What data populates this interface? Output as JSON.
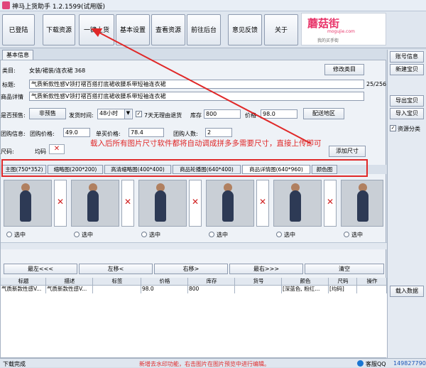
{
  "window": {
    "title": "神马上货助手 1.2.1599(试用版)"
  },
  "toolbar": {
    "buttons": [
      "已登陆",
      "下载资源",
      "一键上货",
      "基本设置",
      "查看资源",
      "前往后台",
      "意见反馈",
      "关于"
    ]
  },
  "logo": {
    "brand": "蘑菇街",
    "domain": "mogujie.com",
    "tagline": "我的买手街"
  },
  "tabs": {
    "basic": "基本信息"
  },
  "form": {
    "category_label": "类目:",
    "category_value": "女装/裙装/连衣裙   368",
    "modify_category": "修改类目",
    "title_label": "标题:",
    "title_value": "气质新款性感V领打褶百搭打底裙收腰系带短袖连衣裙",
    "title_count": "25/256",
    "detail_label": "商品详情",
    "detail_value": "气质新款性感V领打褶百搭打底裙收腰系带短袖连衣裙",
    "presale_label": "是否预售:",
    "presale_btn": "非预售",
    "ship_label": "发货时间:",
    "ship_value": "48小时",
    "refund_label": "7天无理由退货",
    "refund_checked": true,
    "stock_label": "库存",
    "stock_value": "800",
    "price_label": "价格",
    "price_value": "98.0",
    "region_btn": "配送地区",
    "group_label": "团购信息:",
    "group_price_label": "团购价格:",
    "group_price_value": "49.0",
    "single_price_label": "单买价格:",
    "single_price_value": "78.4",
    "group_size_label": "团购人数:",
    "group_size_value": "2",
    "size_label": "尺码:",
    "size_chip": "均码",
    "add_size": "添加尺寸"
  },
  "image_tabs": [
    "主图(750*352)",
    "缩略图(200*200)",
    "高清缩略图(400*400)",
    "商品轮播图(640*400)",
    "商品详情图(640*960)",
    "颜色图"
  ],
  "select_label": "选中",
  "nav": {
    "first": "最左<<<",
    "left": "左移<",
    "right": "右移>",
    "last": "最右>>>",
    "clear": "清空"
  },
  "grid": {
    "headers": [
      "标题",
      "描述",
      "标签",
      "价格",
      "库存",
      "货号",
      "颜色",
      "尺码",
      "操作"
    ],
    "row": [
      "气质新款性感V...",
      "气质新款性感V...",
      "",
      "98.0",
      "800",
      "",
      "[深蓝色, 粉红...",
      "[均码]",
      ""
    ]
  },
  "right_panel": {
    "account_info": "账号信息",
    "new_item": "新建宝贝",
    "export": "导出宝贝",
    "import": "导入宝贝",
    "resource_category": "资源分类",
    "resource_checked": true,
    "load_data": "载入数据"
  },
  "status": {
    "left": "下载完成",
    "notice": "新增去水印功能，右击图片在图片预览中进行编辑。",
    "qq_label": "客服QQ",
    "qq_number": "149827790"
  },
  "annotation": {
    "text": "载入后所有图片尺寸软件都将自动调成拼多多需要尺寸，直接上传即可"
  },
  "colors": {
    "accent_red": "#e02828",
    "brand_pink": "#e8356a"
  }
}
